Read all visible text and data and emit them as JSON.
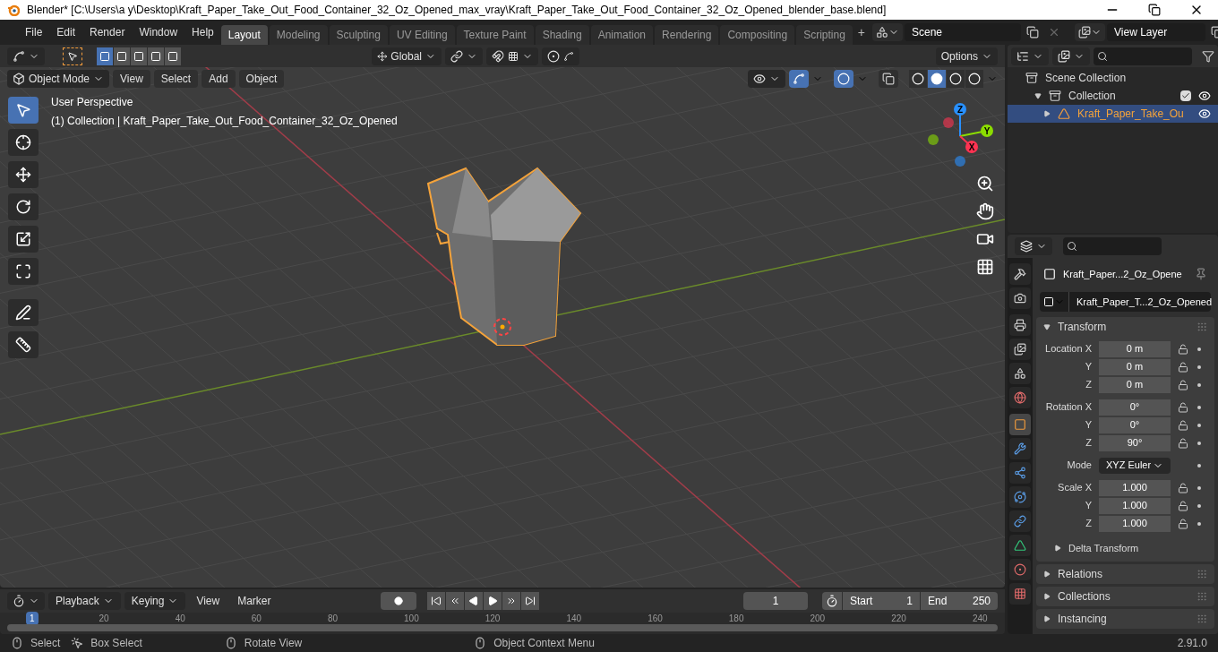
{
  "window": {
    "title": "Blender* [C:\\Users\\a y\\Desktop\\Kraft_Paper_Take_Out_Food_Container_32_Oz_Opened_max_vray\\Kraft_Paper_Take_Out_Food_Container_32_Oz_Opened_blender_base.blend]"
  },
  "menu_bar": {
    "menus": [
      "File",
      "Edit",
      "Render",
      "Window",
      "Help"
    ]
  },
  "workspace_tabs": [
    {
      "label": "Layout",
      "selected": true
    },
    {
      "label": "Modeling",
      "selected": false
    },
    {
      "label": "Sculpting",
      "selected": false
    },
    {
      "label": "UV Editing",
      "selected": false
    },
    {
      "label": "Texture Paint",
      "selected": false
    },
    {
      "label": "Shading",
      "selected": false
    },
    {
      "label": "Animation",
      "selected": false
    },
    {
      "label": "Rendering",
      "selected": false
    },
    {
      "label": "Compositing",
      "selected": false
    },
    {
      "label": "Scripting",
      "selected": false
    }
  ],
  "add_workspace": "+",
  "scene": {
    "value": "Scene"
  },
  "view_layer": {
    "value": "View Layer"
  },
  "tool_header": {
    "select_modes": [
      {
        "selected": true
      },
      {
        "selected": false
      },
      {
        "selected": false
      },
      {
        "selected": false
      },
      {
        "selected": false
      }
    ],
    "orientation": "Global",
    "options": "Options"
  },
  "viewport_header": {
    "mode": "Object Mode",
    "menus": [
      "View",
      "Select",
      "Add",
      "Object"
    ],
    "gizmos_on": true,
    "overlays_on": true,
    "shading": [
      {
        "selected": false
      },
      {
        "selected": true
      },
      {
        "selected": false
      },
      {
        "selected": false
      }
    ]
  },
  "viewport": {
    "perspective": "User Perspective",
    "info": "(1) Collection | Kraft_Paper_Take_Out_Food_Container_32_Oz_Opened",
    "tools": [
      {
        "kind": "select",
        "selected": true
      },
      {
        "kind": "cursor",
        "selected": false
      },
      {
        "kind": "move",
        "selected": false
      },
      {
        "kind": "rotate",
        "selected": false
      },
      {
        "kind": "scale",
        "selected": false
      },
      {
        "kind": "transform",
        "selected": false
      },
      {
        "kind": "annotate",
        "selected": false
      },
      {
        "kind": "measure",
        "selected": false
      }
    ],
    "gizmo_axes": [
      {
        "label": "Z",
        "color": "#2890ff"
      },
      {
        "label": "Y",
        "color": "#8bdc00"
      },
      {
        "label": "X",
        "color": "#ff3352"
      }
    ]
  },
  "timeline": {
    "menus": [
      {
        "label": "Playback",
        "dropdown": true
      },
      {
        "label": "Keying",
        "dropdown": true
      },
      {
        "label": "View",
        "dropdown": false
      },
      {
        "label": "Marker",
        "dropdown": false
      }
    ],
    "current_frame": "1",
    "start_label": "Start",
    "start": "1",
    "end_label": "End",
    "end": "250",
    "ruler": [
      {
        "label": "1",
        "selected": true
      },
      {
        "label": "20",
        "selected": false
      },
      {
        "label": "40",
        "selected": false
      },
      {
        "label": "60",
        "selected": false
      },
      {
        "label": "80",
        "selected": false
      },
      {
        "label": "100",
        "selected": false
      },
      {
        "label": "120",
        "selected": false
      },
      {
        "label": "140",
        "selected": false
      },
      {
        "label": "160",
        "selected": false
      },
      {
        "label": "180",
        "selected": false
      },
      {
        "label": "200",
        "selected": false
      },
      {
        "label": "220",
        "selected": false
      },
      {
        "label": "240",
        "selected": false
      }
    ]
  },
  "outliner": {
    "items": [
      {
        "label": "Scene Collection",
        "kind": "scene",
        "children": [
          {
            "label": "Collection",
            "kind": "collection",
            "expanded": true,
            "checked": true,
            "selected": false,
            "children": [
              {
                "label": "Kraft_Paper_Take_Ou",
                "kind": "mesh",
                "expanded": false,
                "selected": true
              }
            ]
          }
        ]
      }
    ]
  },
  "properties": {
    "tabs": [
      {
        "kind": "tool",
        "selected": false
      },
      {
        "kind": "render",
        "selected": false
      },
      {
        "kind": "output",
        "selected": false
      },
      {
        "kind": "view_layer",
        "selected": false
      },
      {
        "kind": "scene",
        "selected": false
      },
      {
        "kind": "world",
        "selected": false
      },
      {
        "kind": "object",
        "selected": true
      },
      {
        "kind": "modifiers",
        "selected": false
      },
      {
        "kind": "particles",
        "selected": false
      },
      {
        "kind": "physics",
        "selected": false
      },
      {
        "kind": "constraints",
        "selected": false
      },
      {
        "kind": "data",
        "selected": false
      },
      {
        "kind": "material",
        "selected": false
      },
      {
        "kind": "texture",
        "selected": false
      }
    ],
    "object_name": "Kraft_Paper...2_Oz_Opene",
    "datablock": "Kraft_Paper_T...2_Oz_Opened",
    "panels": [
      {
        "title": "Transform",
        "expanded": true,
        "rows": [
          {
            "label": "Location X",
            "value": "0 m",
            "kind": "number"
          },
          {
            "label": "Y",
            "value": "0 m",
            "kind": "number"
          },
          {
            "label": "Z",
            "value": "0 m",
            "kind": "number"
          },
          {
            "label": "Rotation X",
            "value": "0°",
            "kind": "number"
          },
          {
            "label": "Y",
            "value": "0°",
            "kind": "number"
          },
          {
            "label": "Z",
            "value": "90°",
            "kind": "number"
          },
          {
            "label": "Mode",
            "value": "XYZ Euler",
            "kind": "select"
          },
          {
            "label": "Scale X",
            "value": "1.000",
            "kind": "number"
          },
          {
            "label": "Y",
            "value": "1.000",
            "kind": "number"
          },
          {
            "label": "Z",
            "value": "1.000",
            "kind": "number"
          }
        ],
        "subpanels": [
          {
            "title": "Delta Transform",
            "expanded": false
          }
        ]
      },
      {
        "title": "Relations",
        "expanded": false
      },
      {
        "title": "Collections",
        "expanded": false
      },
      {
        "title": "Instancing",
        "expanded": false
      }
    ]
  },
  "status_bar": {
    "hints": [
      {
        "kind": "left",
        "label": "Select"
      },
      {
        "kind": "left_drag",
        "label": "Box Select"
      },
      {
        "kind": "middle",
        "label": "Rotate View"
      },
      {
        "kind": "right",
        "label": "Object Context Menu"
      }
    ],
    "version": "2.91.0"
  }
}
